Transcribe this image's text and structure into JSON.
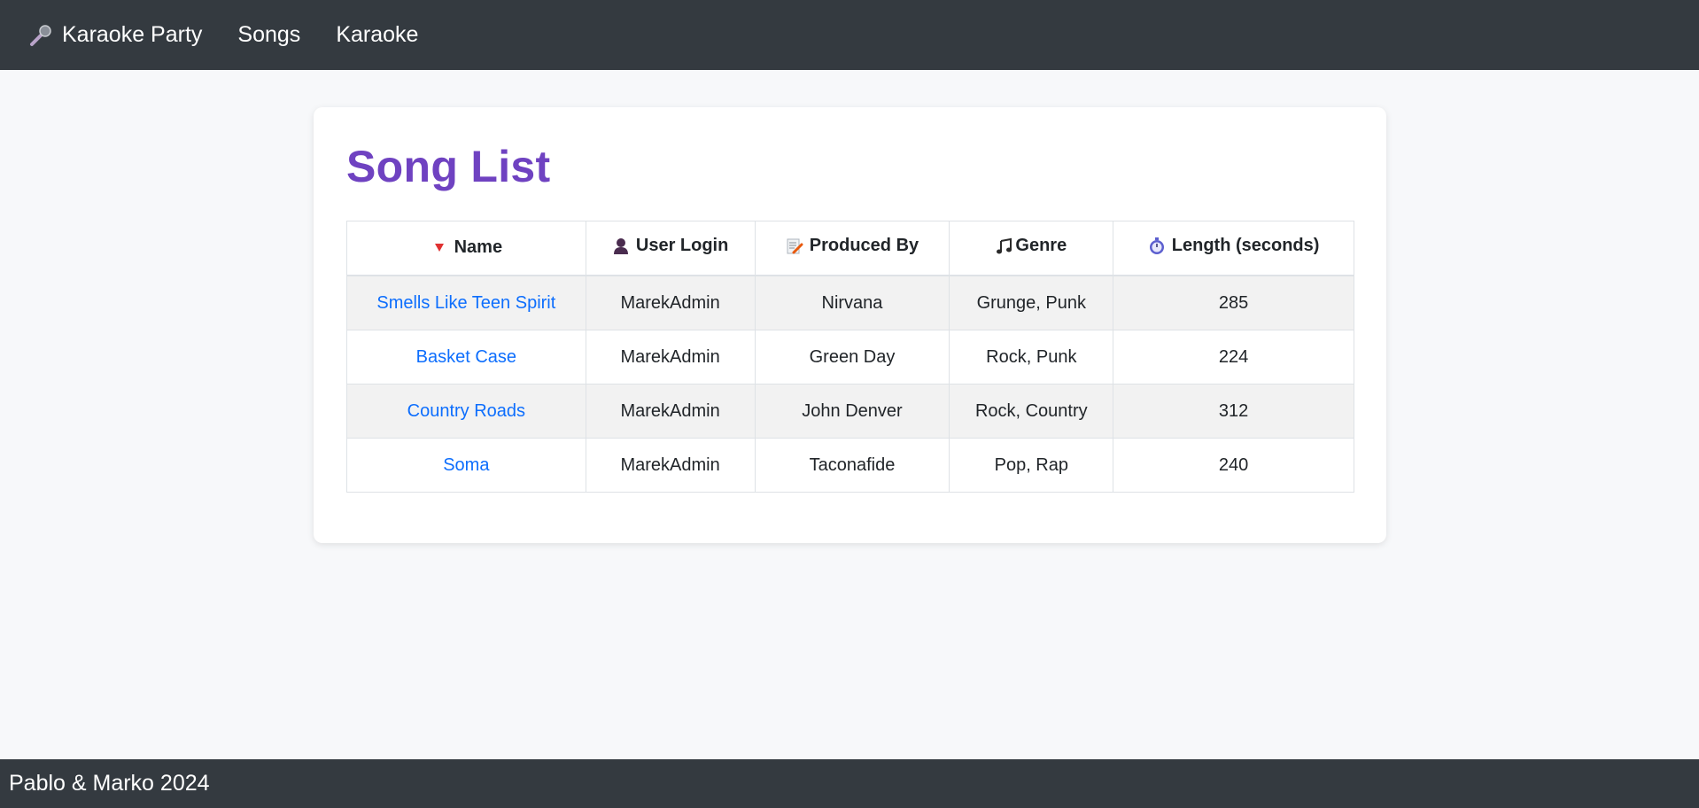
{
  "navbar": {
    "brand_label": "Karaoke Party",
    "brand_icon": "microphone-icon",
    "links": [
      "Songs",
      "Karaoke"
    ]
  },
  "page": {
    "title": "Song List"
  },
  "table": {
    "columns": [
      {
        "label": "Name",
        "icon": "sort-down-icon"
      },
      {
        "label": "User Login",
        "icon": "user-icon"
      },
      {
        "label": "Produced By",
        "icon": "memo-icon"
      },
      {
        "label": "Genre",
        "icon": "music-note-icon"
      },
      {
        "label": "Length (seconds)",
        "icon": "stopwatch-icon"
      }
    ],
    "rows": [
      {
        "name": "Smells Like Teen Spirit",
        "user": "MarekAdmin",
        "producer": "Nirvana",
        "genre": "Grunge, Punk",
        "length": "285"
      },
      {
        "name": "Basket Case",
        "user": "MarekAdmin",
        "producer": "Green Day",
        "genre": "Rock, Punk",
        "length": "224"
      },
      {
        "name": "Country Roads",
        "user": "MarekAdmin",
        "producer": "John Denver",
        "genre": "Rock, Country",
        "length": "312"
      },
      {
        "name": "Soma",
        "user": "MarekAdmin",
        "producer": "Taconafide",
        "genre": "Pop, Rap",
        "length": "240"
      }
    ]
  },
  "footer": {
    "text": "Pablo & Marko 2024"
  },
  "colors": {
    "navbar_bg": "#343a40",
    "title": "#6f42c1",
    "link": "#0d6efd",
    "sort_arrow": "#dc3545"
  }
}
